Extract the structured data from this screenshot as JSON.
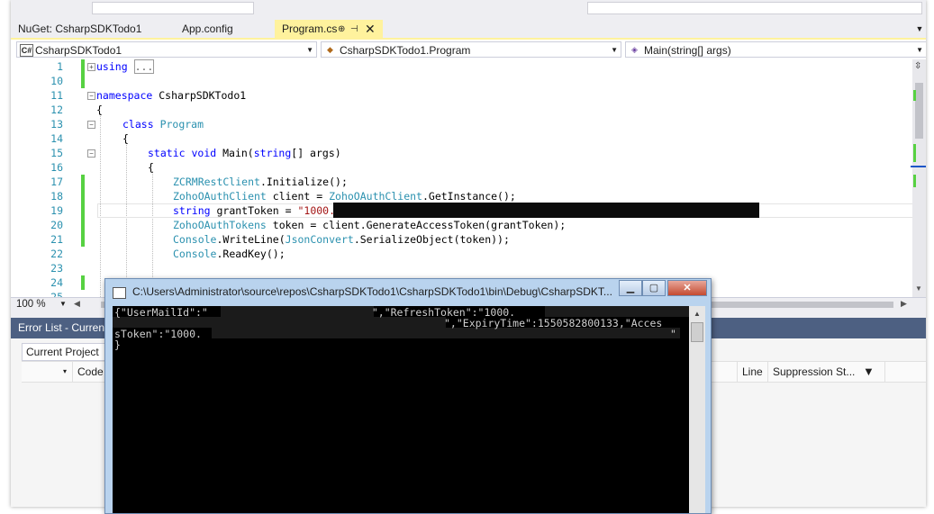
{
  "tabs": [
    {
      "label": "NuGet: CsharpSDKTodo1"
    },
    {
      "label": "App.config"
    },
    {
      "label": "Program.cs",
      "pin": "⊕",
      "close": "✕"
    }
  ],
  "navbar": {
    "project": "CsharpSDKTodo1",
    "class": "CsharpSDKTodo1.Program",
    "member": "Main(string[] args)"
  },
  "editor": {
    "line_numbers": [
      "1",
      "10",
      "11",
      "12",
      "13",
      "14",
      "15",
      "16",
      "17",
      "18",
      "19",
      "20",
      "21",
      "22",
      "23",
      "24",
      "25"
    ],
    "lines": {
      "l1_kw": "using",
      "l1_collapsed": "...",
      "l11_kw": "namespace",
      "l11_name": " CsharpSDKTodo1",
      "brace_open": "{",
      "l13_kw": "class",
      "l13_type": "Program",
      "l15_kw1": "static",
      "l15_kw2": "void",
      "l15_rest1": " Main(",
      "l15_kw3": "string",
      "l15_rest2": "[] args)",
      "l17_type": "ZCRMRestClient",
      "l17_rest": ".Initialize();",
      "l18_type": "ZohoOAuthClient",
      "l18_rest1": " client = ",
      "l18_type2": "ZohoOAuthClient",
      "l18_rest2": ".GetInstance();",
      "l19_kw": "string",
      "l19_rest": " grantToken = ",
      "l19_str": "\"1000.",
      "l20_type": "ZohoOAuthTokens",
      "l20_rest": " token = client.GenerateAccessToken(grantToken);",
      "l21_type": "Console",
      "l21_rest1": ".WriteLine(",
      "l21_type2": "JsonConvert",
      "l21_rest2": ".SerializeObject(token));",
      "l22_type": "Console",
      "l22_rest": ".ReadKey();"
    }
  },
  "zoom": "100 %",
  "error_list": {
    "title": "Error List - Curren",
    "scope": "Current Project",
    "columns": {
      "code": "Code",
      "line": "Line",
      "suppression": "Suppression St..."
    }
  },
  "console": {
    "title": "C:\\Users\\Administrator\\source\\repos\\CsharpSDKTodo1\\CsharpSDKTodo1\\bin\\Debug\\CsharpSDKT...",
    "line1a": "{\"UserMailId\":\"",
    "line1b": "\",\"RefreshToken\":\"1000.",
    "line2": "\",\"ExpiryTime\":1550582800133,\"Acces",
    "line3a": "sToken\":\"1000.",
    "line3b": "\"",
    "line4": "}"
  },
  "colors": {
    "tab_active": "#fff29d",
    "error_list_title": "#4d6082",
    "change_marker": "#57d142",
    "keyword": "#0000ff",
    "type": "#2b91af",
    "string": "#a31515"
  }
}
